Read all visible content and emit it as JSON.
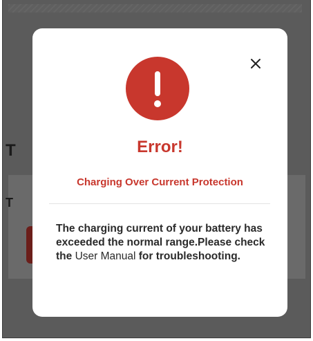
{
  "background": {
    "heading_letter": "T",
    "card_letter": "T"
  },
  "modal": {
    "icon": "exclamation-icon",
    "close_icon": "close-icon",
    "title": "Error!",
    "subtitle": "Charging Over Current Protection",
    "message_prefix": "The charging current of your battery has exceeded the normal range.Please check the ",
    "message_link": "User Manual",
    "message_suffix": " for troubleshooting."
  },
  "colors": {
    "accent": "#c8372d",
    "overlay": "#5b5b5b",
    "text": "#2a2a2a"
  }
}
